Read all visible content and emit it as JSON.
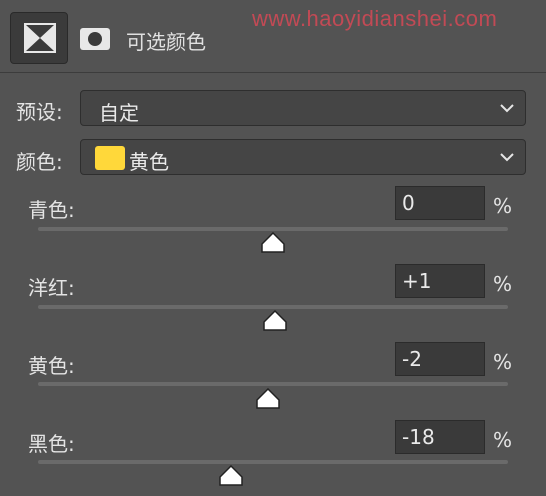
{
  "header": {
    "title": "可选颜色",
    "watermark": "www.haoyidianshei.com"
  },
  "preset": {
    "label": "预设:",
    "value": "自定"
  },
  "colors": {
    "label": "颜色:",
    "value": "黄色",
    "swatch": "#ffd83a"
  },
  "sliders": [
    {
      "label": "青色:",
      "value": "0",
      "percent": "%",
      "position": 0.5
    },
    {
      "label": "洋红:",
      "value": "+1",
      "percent": "%",
      "position": 0.505
    },
    {
      "label": "黄色:",
      "value": "-2",
      "percent": "%",
      "position": 0.49
    },
    {
      "label": "黑色:",
      "value": "-18",
      "percent": "%",
      "position": 0.41
    }
  ],
  "icons": [
    "adjustment-mask-icon",
    "layer-mask-circle-icon",
    "chevron-down-icon"
  ]
}
